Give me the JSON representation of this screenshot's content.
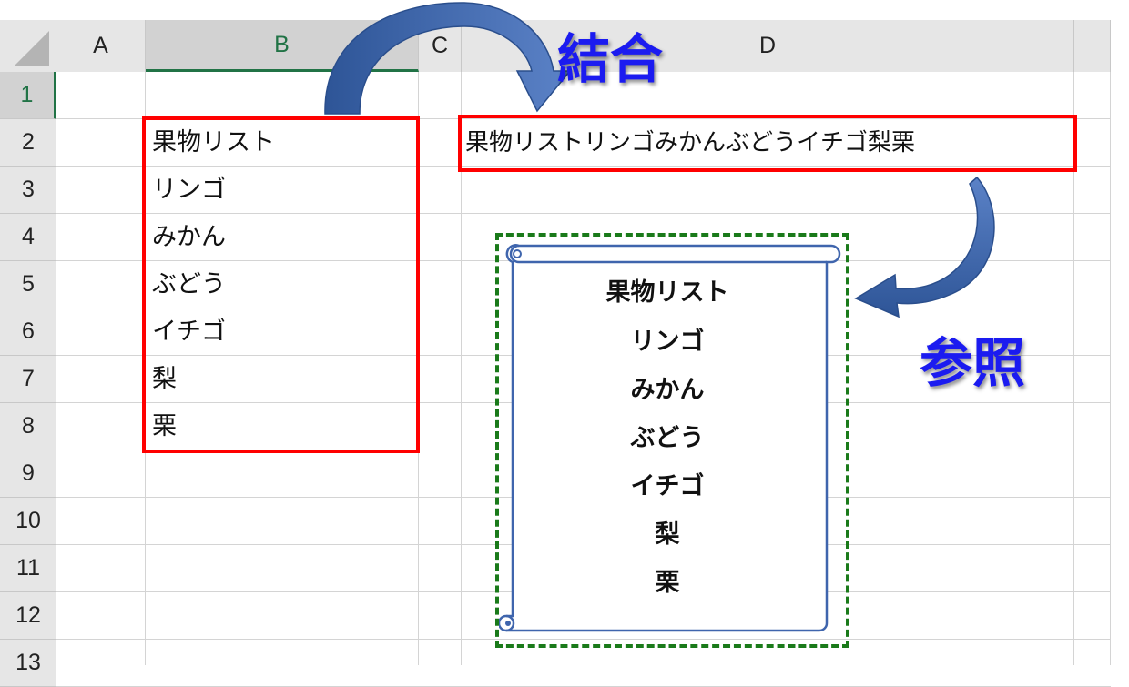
{
  "columns": [
    "A",
    "B",
    "C",
    "D"
  ],
  "rows": [
    "1",
    "2",
    "3",
    "4",
    "5",
    "6",
    "7",
    "8",
    "9",
    "10",
    "11",
    "12",
    "13"
  ],
  "cells": {
    "B2": "果物リスト",
    "B3": "リンゴ",
    "B4": "みかん",
    "B5": "ぶどう",
    "B6": "イチゴ",
    "B7": "梨",
    "B8": "栗",
    "D2": "果物リストリンゴみかんぶどうイチゴ梨栗"
  },
  "scroll_items": [
    "果物リスト",
    "リンゴ",
    "みかん",
    "ぶどう",
    "イチゴ",
    "梨",
    "栗"
  ],
  "labels": {
    "combine": "結合",
    "reference": "参照"
  },
  "colors": {
    "source_box": "#ff0000",
    "result_box": "#ff0000",
    "scroll_border": "#1a7a1a",
    "arrow": "#3f65ad",
    "label": "#1b1bf0"
  }
}
